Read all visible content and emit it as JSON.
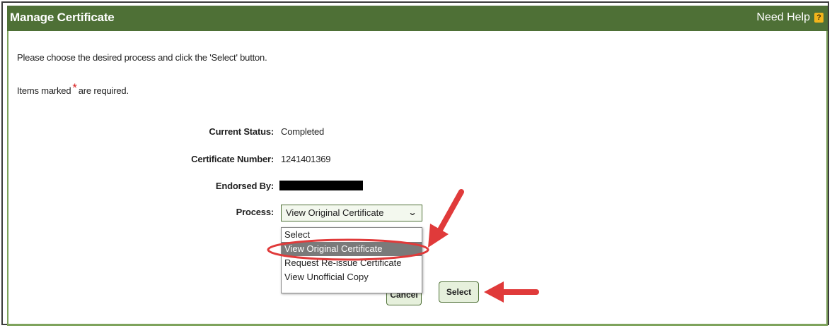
{
  "header": {
    "title": "Manage Certificate",
    "help_label": "Need Help",
    "help_icon": "?"
  },
  "instructions": {
    "line1": "Please choose the desired process and click the 'Select' button.",
    "line2_prefix": "Items marked",
    "line2_star": "*",
    "line2_suffix": "are required."
  },
  "fields": {
    "status_label": "Current Status:",
    "status_value": "Completed",
    "cert_label": "Certificate Number:",
    "cert_value": "1241401369",
    "endorsed_label": "Endorsed By:",
    "process_label": "Process:"
  },
  "process_select": {
    "selected": "View Original Certificate",
    "caret": "⌄",
    "options": [
      "Select",
      "View Original Certificate",
      "Request Re-issue Certificate",
      "View Unofficial Copy"
    ]
  },
  "buttons": {
    "cancel_label": "Cancel",
    "select_label": "Select"
  },
  "colors": {
    "header_bg": "#4e7036",
    "annotation": "#e03a3a",
    "required_star": "#d81d1d"
  }
}
